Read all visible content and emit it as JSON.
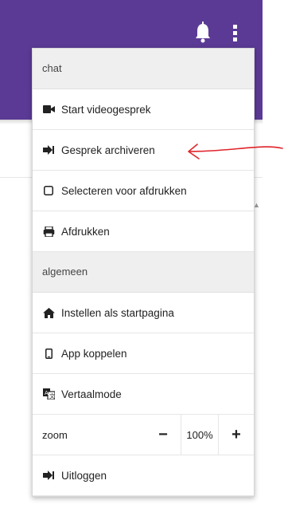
{
  "icons": {
    "bell": "bell-icon",
    "more": "kebab-menu-icon",
    "video": "video-camera-icon",
    "archive": "sign-out-arrow-icon",
    "checkbox": "checkbox-icon",
    "print": "printer-icon",
    "home": "home-icon",
    "phone": "mobile-phone-icon",
    "translate": "translate-icon",
    "logout": "sign-out-arrow-icon"
  },
  "colors": {
    "header": "#5b3a95",
    "annotation_arrow": "#e0242a"
  },
  "menu": {
    "chat_section": "chat",
    "start_video": "Start videogesprek",
    "archive_chat": "Gesprek archiveren",
    "select_print": "Selecteren voor afdrukken",
    "print": "Afdrukken",
    "general_section": "algemeen",
    "set_homepage": "Instellen als startpagina",
    "link_app": "App koppelen",
    "translate_mode": "Vertaalmode",
    "zoom_label": "zoom",
    "zoom_minus": "−",
    "zoom_value": "100%",
    "zoom_plus": "+",
    "logout": "Uitloggen"
  }
}
